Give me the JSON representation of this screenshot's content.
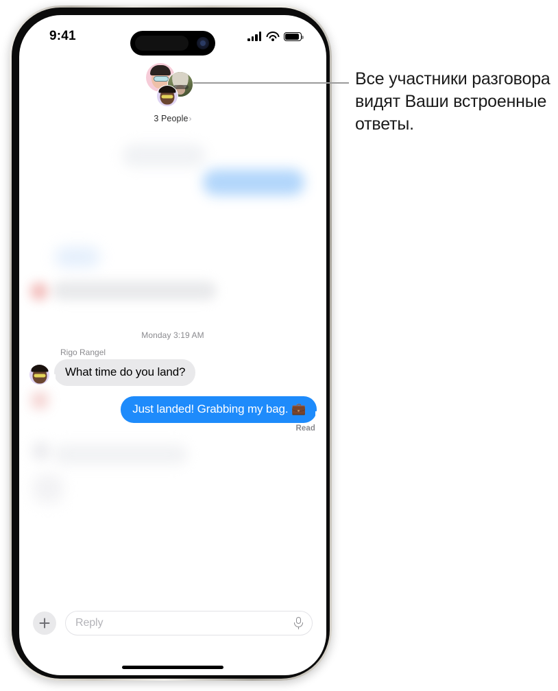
{
  "status_bar": {
    "time": "9:41",
    "icons": [
      "cellular-signal-icon",
      "wifi-icon",
      "battery-icon"
    ]
  },
  "chat_header": {
    "participants_label": "3 People",
    "chevron": "›",
    "avatars": [
      {
        "name": "memoji-avatar-female",
        "bg": "#f6ccd8"
      },
      {
        "name": "photo-avatar-older-woman",
        "bg": "#6f7a57"
      },
      {
        "name": "memoji-avatar-male",
        "bg": "#ded3f2"
      }
    ]
  },
  "conversation": {
    "day_stamp": "Monday 3:19 AM",
    "messages": [
      {
        "id": "incoming-1",
        "sender": "Rigo Rangel",
        "text": "What time do you land?",
        "direction": "incoming"
      },
      {
        "id": "outgoing-1",
        "text": "Just landed! Grabbing my bag. 💼",
        "direction": "outgoing",
        "receipt": "Read"
      }
    ]
  },
  "input_bar": {
    "add_label": "+",
    "reply_placeholder": "Reply",
    "mic_icon": "microphone-icon"
  },
  "callout": {
    "text": "Все участники разговора видят Ваши встроенные ответы."
  },
  "colors": {
    "imessage_blue": "#1e8bfb",
    "incoming_gray": "#e9e9eb",
    "secondary_text": "#8a8a8e",
    "callout_line": "#9a9a9a"
  }
}
